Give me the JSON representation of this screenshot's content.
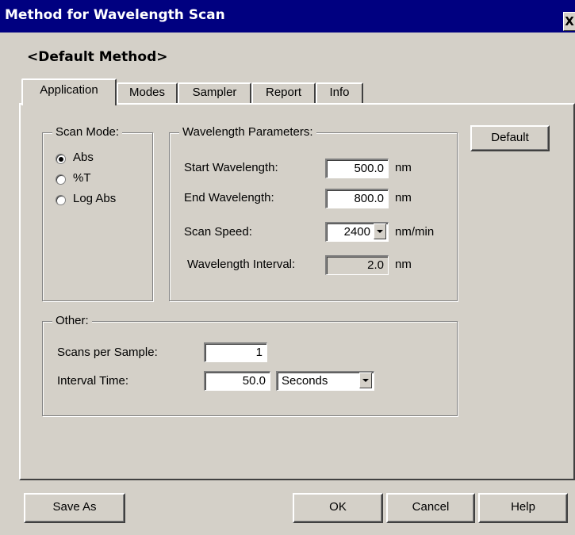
{
  "window": {
    "title": "Method for Wavelength Scan",
    "close_label": "X"
  },
  "method_name": "<Default Method>",
  "tabs": [
    {
      "label": "Application",
      "active": true
    },
    {
      "label": "Modes",
      "active": false
    },
    {
      "label": "Sampler",
      "active": false
    },
    {
      "label": "Report",
      "active": false
    },
    {
      "label": "Info",
      "active": false
    }
  ],
  "scan_mode": {
    "title": "Scan Mode:",
    "options": [
      {
        "label": "Abs",
        "selected": true
      },
      {
        "label": "%T",
        "selected": false
      },
      {
        "label": "Log Abs",
        "selected": false
      }
    ]
  },
  "wavelength_params": {
    "title": "Wavelength Parameters:",
    "start_label": "Start Wavelength:",
    "start_value": "500.0",
    "start_unit": "nm",
    "end_label": "End Wavelength:",
    "end_value": "800.0",
    "end_unit": "nm",
    "speed_label": "Scan Speed:",
    "speed_value": "2400",
    "speed_unit": "nm/min",
    "interval_label": "Wavelength Interval:",
    "interval_value": "2.0",
    "interval_unit": "nm"
  },
  "default_button": "Default",
  "other": {
    "title": "Other:",
    "scans_label": "Scans per Sample:",
    "scans_value": "1",
    "interval_time_label": "Interval Time:",
    "interval_time_value": "50.0",
    "interval_time_unit": "Seconds"
  },
  "buttons": {
    "save_as": "Save As",
    "ok": "OK",
    "cancel": "Cancel",
    "help": "Help"
  },
  "colors": {
    "title_bar": "#000080",
    "face": "#d4d0c8"
  },
  "icons": {
    "dropdown": "chevron-down-icon",
    "close": "close-icon"
  }
}
